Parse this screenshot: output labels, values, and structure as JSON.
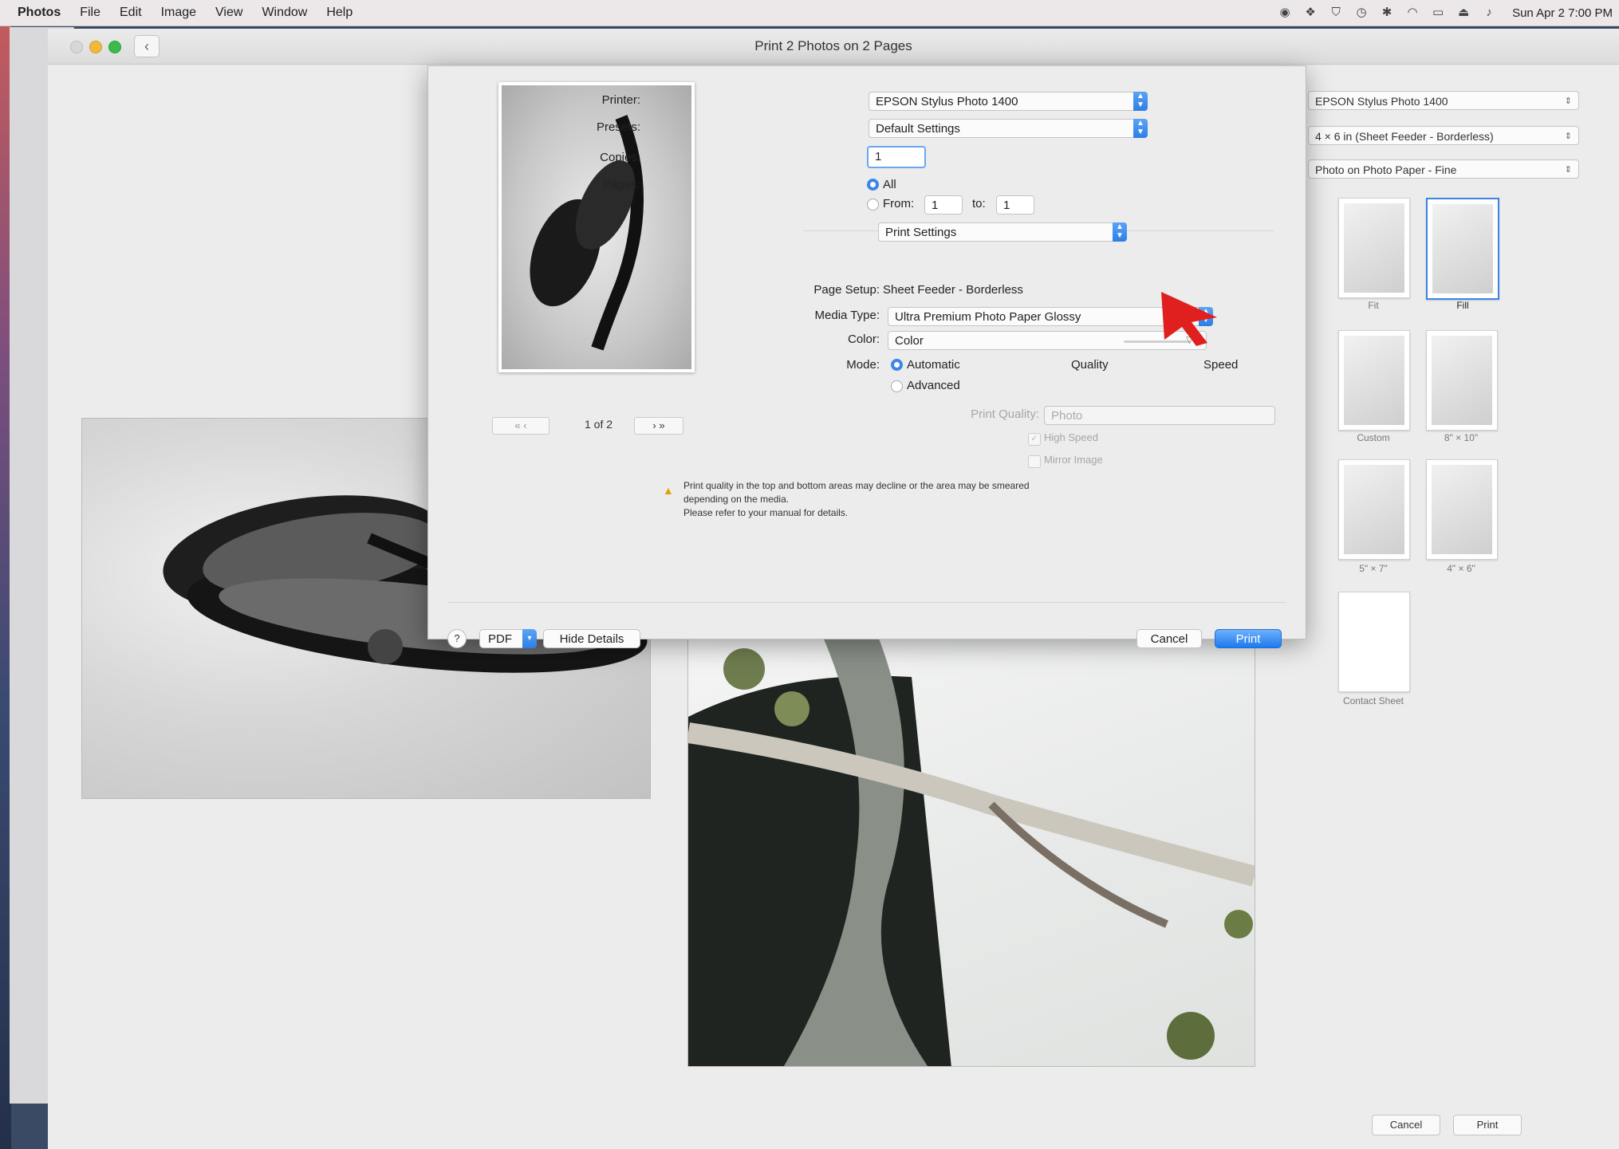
{
  "menubar": {
    "app_name": "Photos",
    "items": [
      "File",
      "Edit",
      "Image",
      "View",
      "Window",
      "Help"
    ],
    "clock": "Sun Apr 2 7:00 PM",
    "status_icons": [
      "screen-icon",
      "dropbox-icon",
      "shield-icon",
      "clock-icon",
      "bluetooth-icon",
      "wifi-icon",
      "airplay-icon",
      "eject-icon",
      "volume-icon"
    ]
  },
  "window": {
    "title": "Print 2 Photos on 2 Pages"
  },
  "print_dialog": {
    "page_indicator": "1 of 2",
    "printer_label": "Printer:",
    "printer_value": "EPSON Stylus Photo 1400",
    "presets_label": "Presets:",
    "presets_value": "Default Settings",
    "copies_label": "Copies:",
    "copies_value": "1",
    "pages_label": "Pages:",
    "pages_all": "All",
    "pages_from": "From:",
    "pages_from_value": "1",
    "pages_to": "to:",
    "pages_to_value": "1",
    "section_popup": "Print Settings",
    "page_setup_label": "Page Setup:",
    "page_setup_value": "Sheet Feeder - Borderless",
    "media_type_label": "Media Type:",
    "media_type_value": "Ultra Premium Photo Paper Glossy",
    "color_label": "Color:",
    "color_value": "Color",
    "mode_label": "Mode:",
    "mode_automatic": "Automatic",
    "mode_advanced": "Advanced",
    "quality_label": "Quality",
    "speed_label": "Speed",
    "print_quality_label": "Print Quality:",
    "print_quality_value": "Photo",
    "high_speed_label": "High Speed",
    "mirror_image_label": "Mirror Image",
    "warning_line1": "Print quality in the top and bottom areas may decline or the area may be smeared",
    "warning_line2": "depending on the media.",
    "warning_line3": "Please refer to your manual for details.",
    "help_label": "?",
    "pdf_label": "PDF",
    "hide_details_label": "Hide Details",
    "cancel_label": "Cancel",
    "print_label": "Print"
  },
  "sidebar": {
    "printer_select": "EPSON Stylus Photo 1400",
    "paper_select": "4 × 6 in (Sheet Feeder - Borderless)",
    "media_select": "Photo on Photo Paper - Fine",
    "layouts": [
      {
        "label": "Fit",
        "selected": false
      },
      {
        "label": "Fill",
        "selected": true
      },
      {
        "label": "Custom",
        "selected": false
      },
      {
        "label": "8\" × 10\"",
        "selected": false
      },
      {
        "label": "5\" × 7\"",
        "selected": false
      },
      {
        "label": "4\" × 6\"",
        "selected": false
      },
      {
        "label": "Contact Sheet",
        "selected": false
      }
    ],
    "cancel_label": "Cancel",
    "print_label": "Print"
  },
  "colors": {
    "accent": "#3b86ea",
    "cursor": "#e0201e"
  }
}
